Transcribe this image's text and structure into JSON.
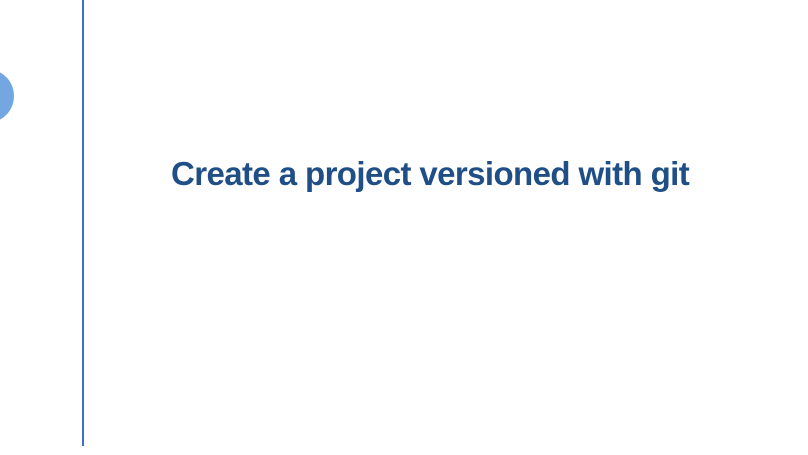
{
  "slide": {
    "title": "Create a project versioned with git"
  },
  "colors": {
    "background": "#ffffff",
    "title": "#1f4f86",
    "divider": "#3f6fc4",
    "accent_circle": "#74a7e2"
  }
}
